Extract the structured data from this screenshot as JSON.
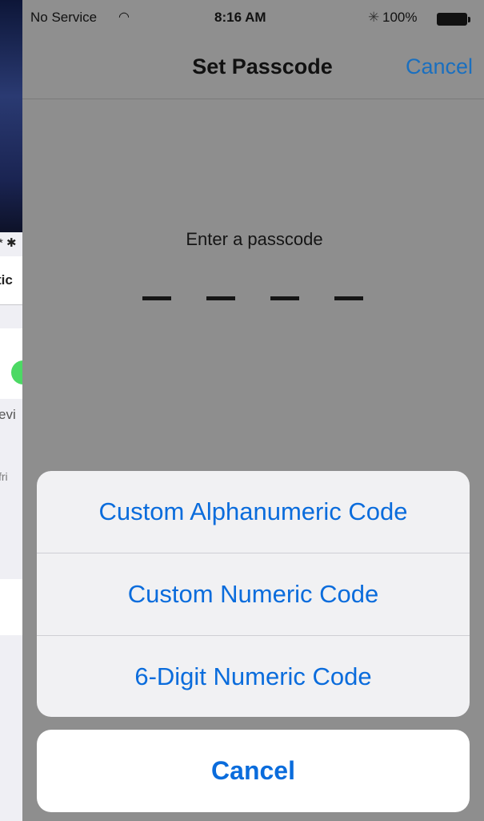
{
  "status_bar": {
    "carrier": "No Service",
    "wifi_icon": "wifi-icon",
    "time": "8:16 AM",
    "bluetooth_icon": "bluetooth-icon",
    "battery_percent": "100%",
    "battery_level": 1.0
  },
  "navigation": {
    "title": "Set Passcode",
    "cancel_label": "Cancel"
  },
  "passcode": {
    "prompt": "Enter a passcode",
    "digit_slots": 4
  },
  "action_sheet": {
    "options": [
      {
        "label": "Custom Alphanumeric Code"
      },
      {
        "label": "Custom Numeric Code"
      },
      {
        "label": "6-Digit Numeric Code"
      }
    ],
    "cancel_label": "Cancel"
  },
  "background_screen": {
    "fragments": [
      "* ✱",
      "tic",
      "evi",
      "fri"
    ]
  },
  "colors": {
    "accent": "#0a6cdc",
    "overlay": "#8e8e8e",
    "sheet": "#f1f1f3"
  }
}
